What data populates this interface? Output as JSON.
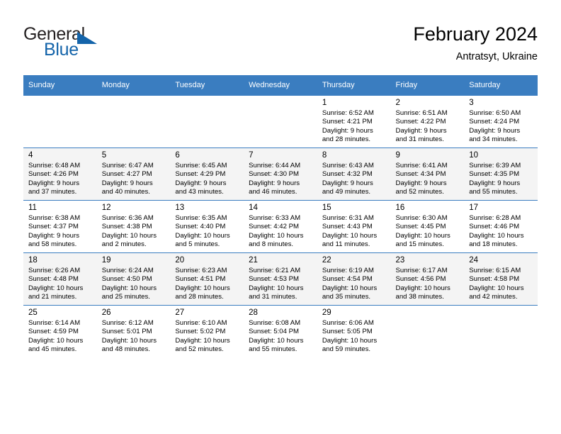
{
  "brand": {
    "name_top": "General",
    "name_bottom": "Blue",
    "accent_color": "#1464aa",
    "triangle_icon": "brand-triangle-icon"
  },
  "header": {
    "title": "February 2024",
    "subtitle": "Antratsyt, Ukraine"
  },
  "theme": {
    "header_bg": "#3a7dc0",
    "header_text": "#ffffff",
    "row_alt_bg": "#f4f4f4",
    "grid_line": "#3a7dc0"
  },
  "calendar": {
    "weekday_headers": [
      "Sunday",
      "Monday",
      "Tuesday",
      "Wednesday",
      "Thursday",
      "Friday",
      "Saturday"
    ],
    "weeks": [
      [
        {
          "day": "",
          "info": ""
        },
        {
          "day": "",
          "info": ""
        },
        {
          "day": "",
          "info": ""
        },
        {
          "day": "",
          "info": ""
        },
        {
          "day": "1",
          "info": "Sunrise: 6:52 AM\nSunset: 4:21 PM\nDaylight: 9 hours\nand 28 minutes."
        },
        {
          "day": "2",
          "info": "Sunrise: 6:51 AM\nSunset: 4:22 PM\nDaylight: 9 hours\nand 31 minutes."
        },
        {
          "day": "3",
          "info": "Sunrise: 6:50 AM\nSunset: 4:24 PM\nDaylight: 9 hours\nand 34 minutes."
        }
      ],
      [
        {
          "day": "4",
          "info": "Sunrise: 6:48 AM\nSunset: 4:26 PM\nDaylight: 9 hours\nand 37 minutes."
        },
        {
          "day": "5",
          "info": "Sunrise: 6:47 AM\nSunset: 4:27 PM\nDaylight: 9 hours\nand 40 minutes."
        },
        {
          "day": "6",
          "info": "Sunrise: 6:45 AM\nSunset: 4:29 PM\nDaylight: 9 hours\nand 43 minutes."
        },
        {
          "day": "7",
          "info": "Sunrise: 6:44 AM\nSunset: 4:30 PM\nDaylight: 9 hours\nand 46 minutes."
        },
        {
          "day": "8",
          "info": "Sunrise: 6:43 AM\nSunset: 4:32 PM\nDaylight: 9 hours\nand 49 minutes."
        },
        {
          "day": "9",
          "info": "Sunrise: 6:41 AM\nSunset: 4:34 PM\nDaylight: 9 hours\nand 52 minutes."
        },
        {
          "day": "10",
          "info": "Sunrise: 6:39 AM\nSunset: 4:35 PM\nDaylight: 9 hours\nand 55 minutes."
        }
      ],
      [
        {
          "day": "11",
          "info": "Sunrise: 6:38 AM\nSunset: 4:37 PM\nDaylight: 9 hours\nand 58 minutes."
        },
        {
          "day": "12",
          "info": "Sunrise: 6:36 AM\nSunset: 4:38 PM\nDaylight: 10 hours\nand 2 minutes."
        },
        {
          "day": "13",
          "info": "Sunrise: 6:35 AM\nSunset: 4:40 PM\nDaylight: 10 hours\nand 5 minutes."
        },
        {
          "day": "14",
          "info": "Sunrise: 6:33 AM\nSunset: 4:42 PM\nDaylight: 10 hours\nand 8 minutes."
        },
        {
          "day": "15",
          "info": "Sunrise: 6:31 AM\nSunset: 4:43 PM\nDaylight: 10 hours\nand 11 minutes."
        },
        {
          "day": "16",
          "info": "Sunrise: 6:30 AM\nSunset: 4:45 PM\nDaylight: 10 hours\nand 15 minutes."
        },
        {
          "day": "17",
          "info": "Sunrise: 6:28 AM\nSunset: 4:46 PM\nDaylight: 10 hours\nand 18 minutes."
        }
      ],
      [
        {
          "day": "18",
          "info": "Sunrise: 6:26 AM\nSunset: 4:48 PM\nDaylight: 10 hours\nand 21 minutes."
        },
        {
          "day": "19",
          "info": "Sunrise: 6:24 AM\nSunset: 4:50 PM\nDaylight: 10 hours\nand 25 minutes."
        },
        {
          "day": "20",
          "info": "Sunrise: 6:23 AM\nSunset: 4:51 PM\nDaylight: 10 hours\nand 28 minutes."
        },
        {
          "day": "21",
          "info": "Sunrise: 6:21 AM\nSunset: 4:53 PM\nDaylight: 10 hours\nand 31 minutes."
        },
        {
          "day": "22",
          "info": "Sunrise: 6:19 AM\nSunset: 4:54 PM\nDaylight: 10 hours\nand 35 minutes."
        },
        {
          "day": "23",
          "info": "Sunrise: 6:17 AM\nSunset: 4:56 PM\nDaylight: 10 hours\nand 38 minutes."
        },
        {
          "day": "24",
          "info": "Sunrise: 6:15 AM\nSunset: 4:58 PM\nDaylight: 10 hours\nand 42 minutes."
        }
      ],
      [
        {
          "day": "25",
          "info": "Sunrise: 6:14 AM\nSunset: 4:59 PM\nDaylight: 10 hours\nand 45 minutes."
        },
        {
          "day": "26",
          "info": "Sunrise: 6:12 AM\nSunset: 5:01 PM\nDaylight: 10 hours\nand 48 minutes."
        },
        {
          "day": "27",
          "info": "Sunrise: 6:10 AM\nSunset: 5:02 PM\nDaylight: 10 hours\nand 52 minutes."
        },
        {
          "day": "28",
          "info": "Sunrise: 6:08 AM\nSunset: 5:04 PM\nDaylight: 10 hours\nand 55 minutes."
        },
        {
          "day": "29",
          "info": "Sunrise: 6:06 AM\nSunset: 5:05 PM\nDaylight: 10 hours\nand 59 minutes."
        },
        {
          "day": "",
          "info": ""
        },
        {
          "day": "",
          "info": ""
        }
      ]
    ]
  }
}
